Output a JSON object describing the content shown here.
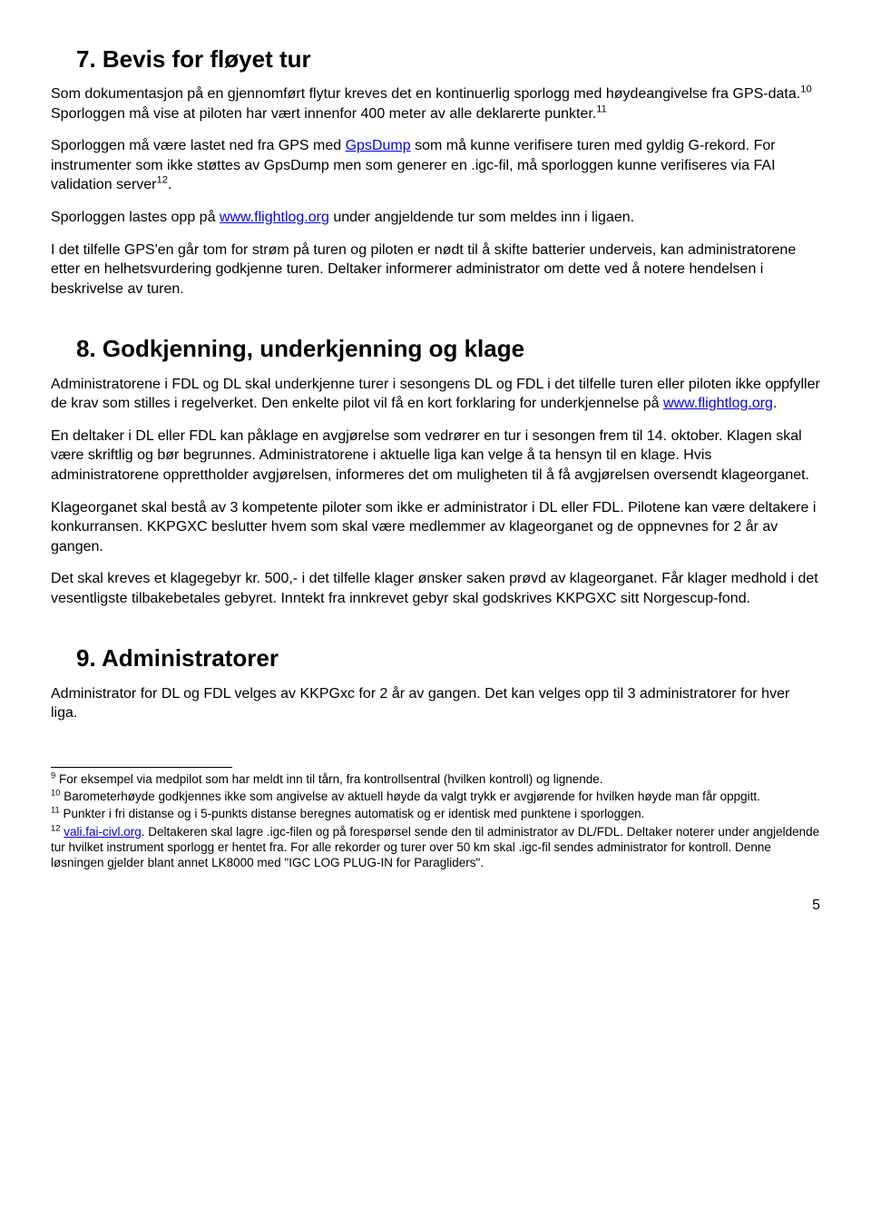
{
  "sections": {
    "s7": {
      "heading": "7. Bevis for fløyet tur",
      "p1a": "Som dokumentasjon på en gjennomført flytur kreves det en kontinuerlig sporlogg med høydeangivelse fra GPS-data.",
      "sup1": "10",
      "p1b": " Sporloggen må vise at piloten har vært innenfor 400 meter av alle deklarerte punkter.",
      "sup2": "11",
      "p2a": "Sporloggen må være lastet ned fra GPS med ",
      "link1": "GpsDump",
      "p2b": " som må kunne verifisere turen med gyldig G-rekord. For instrumenter som ikke støttes av GpsDump men som generer en .igc-fil, må sporloggen kunne verifiseres via FAI validation server",
      "sup3": "12",
      "p2c": ".",
      "p3a": "Sporloggen lastes opp på ",
      "link2": "www.flightlog.org",
      "p3b": " under angjeldende tur som meldes inn i ligaen.",
      "p4": "I det tilfelle GPS'en går tom for strøm på turen og piloten er nødt til å skifte batterier underveis, kan administratorene etter en helhetsvurdering godkjenne turen. Deltaker informerer administrator om dette ved å notere hendelsen i beskrivelse av turen."
    },
    "s8": {
      "heading": "8. Godkjenning, underkjenning og klage",
      "p1a": "Administratorene i FDL og DL skal underkjenne turer i sesongens DL og FDL i det tilfelle turen eller piloten ikke oppfyller de krav som stilles i regelverket. Den enkelte pilot vil få en kort forklaring for underkjennelse på ",
      "link1": "www.flightlog.org",
      "p1b": ".",
      "p2": "En deltaker i DL eller FDL kan påklage en avgjørelse som vedrører en tur i sesongen frem til 14. oktober. Klagen skal være skriftlig og bør begrunnes. Administratorene i aktuelle liga kan velge å ta hensyn til en klage. Hvis administratorene opprettholder avgjørelsen, informeres det om muligheten til å få avgjørelsen oversendt klageorganet.",
      "p3": "Klageorganet skal bestå av 3 kompetente piloter som ikke er administrator i DL eller FDL. Pilotene kan være deltakere i konkurransen. KKPGXC beslutter hvem som skal være medlemmer av klageorganet og de oppnevnes for 2 år av gangen.",
      "p4": "Det skal kreves et klagegebyr kr. 500,- i det tilfelle klager ønsker saken prøvd av klageorganet. Får klager medhold i det vesentligste tilbakebetales gebyret. Inntekt fra innkrevet gebyr skal godskrives KKPGXC sitt Norgescup-fond."
    },
    "s9": {
      "heading": "9. Administratorer",
      "p1": "Administrator for DL og FDL velges av KKPGxc for 2 år av gangen. Det kan velges opp til 3 administratorer for hver liga."
    }
  },
  "footnotes": {
    "f9": {
      "num": "9",
      "text": " For eksempel via medpilot som har meldt inn til tårn, fra kontrollsentral (hvilken kontroll)  og lignende."
    },
    "f10": {
      "num": "10",
      "text": " Barometerhøyde godkjennes ikke som angivelse av aktuell høyde da valgt trykk er avgjørende for hvilken høyde man får oppgitt."
    },
    "f11": {
      "num": "11",
      "text": " Punkter i fri distanse og i 5-punkts distanse beregnes automatisk og er identisk med punktene i sporloggen."
    },
    "f12": {
      "num": "12",
      "link": "vali.fai-civl.org",
      "text": ". Deltakeren skal lagre .igc-filen og på forespørsel sende den til administrator av DL/FDL. Deltaker noterer under angjeldende tur hvilket instrument sporlogg er hentet fra. For alle rekorder og turer over 50 km skal .igc-fil sendes administrator for kontroll. Denne løsningen gjelder blant annet LK8000 med \"IGC LOG PLUG-IN for Paragliders\"."
    }
  },
  "pagenum": "5"
}
